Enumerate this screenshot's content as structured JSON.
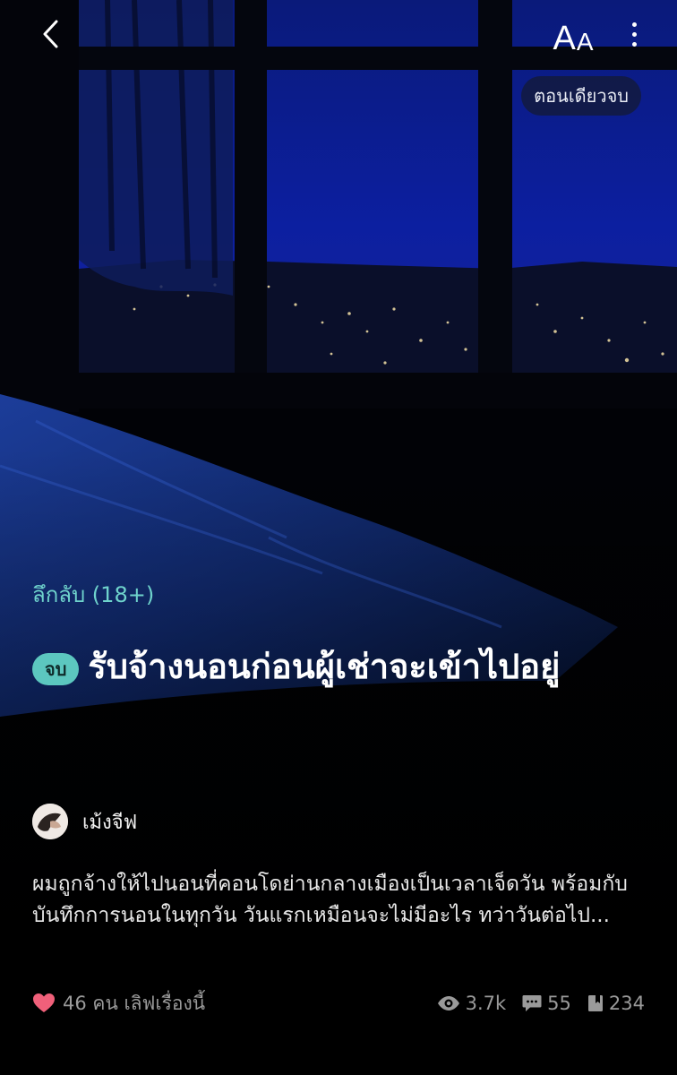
{
  "header": {
    "back_icon": "chevron-left-icon",
    "font_size_label_big": "A",
    "font_size_label_small": "A",
    "more_icon": "more-vertical-icon",
    "oneshot_label": "ตอนเดียวจบ"
  },
  "story": {
    "genre": "ลึกลับ (18+)",
    "status_badge": "จบ",
    "title": "รับจ้างนอนก่อนผู้เช่าจะเข้าไปอยู่",
    "author": "เม้งจีฟ",
    "synopsis": "ผมถูกจ้างให้ไปนอนที่คอนโดย่านกลางเมืองเป็นเวลาเจ็ดวัน พร้อมกับบันทึกการนอนในทุกวัน วันแรกเหมือนจะไม่มีอะไร ทว่าวันต่อไป..."
  },
  "footer": {
    "love_text": "46 คน เลิฟเรื่องนี้",
    "views": "3.7k",
    "comments": "55",
    "bookmarks": "234"
  },
  "colors": {
    "accent": "#5cc7bf",
    "genre": "#6fd3cc",
    "heart": "#f0607a",
    "muted": "#9a9a9a"
  }
}
